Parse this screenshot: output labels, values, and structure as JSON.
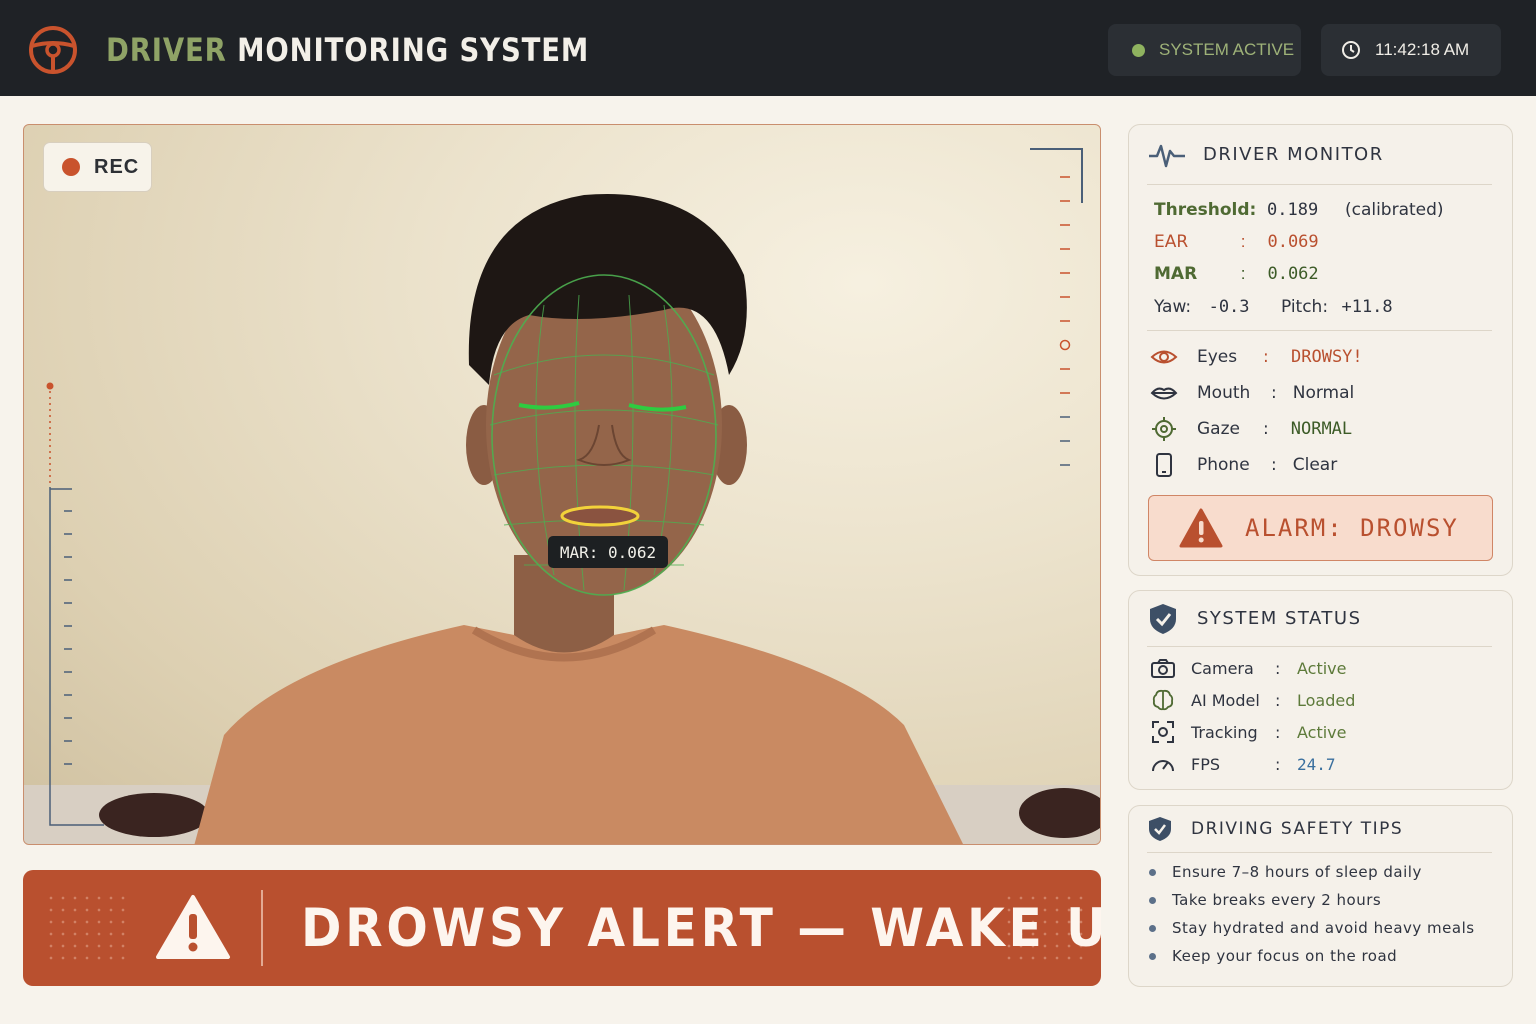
{
  "header": {
    "title_accent": "DRIVER",
    "title_rest": "MONITORING SYSTEM",
    "status_label": "SYSTEM ACTIVE",
    "clock": "11:42:18 AM",
    "logo_icon": "steering-wheel-icon"
  },
  "camera": {
    "rec_label": "REC",
    "mar_overlay": "MAR: 0.062"
  },
  "alert_banner": {
    "text": "DROWSY ALERT — WAKE UP!",
    "icon": "warning-icon"
  },
  "driver_monitor": {
    "title": "DRIVER MONITOR",
    "threshold_label": "Threshold:",
    "threshold_value": "0.189",
    "threshold_note": "(calibrated)",
    "ear_label": "EAR",
    "ear_value": "0.069",
    "mar_label": "MAR",
    "mar_value": "0.062",
    "yaw_label": "Yaw:",
    "yaw_value": "-0.3",
    "pitch_label": "Pitch:",
    "pitch_value": "+11.8",
    "statuses": [
      {
        "label": "Eyes",
        "value": "DROWSY!",
        "icon": "eye-icon"
      },
      {
        "label": "Mouth",
        "value": "Normal",
        "icon": "lips-icon"
      },
      {
        "label": "Gaze",
        "value": "NORMAL",
        "icon": "target-icon"
      },
      {
        "label": "Phone",
        "value": "Clear",
        "icon": "phone-icon"
      }
    ],
    "alarm_text": "ALARM: DROWSY"
  },
  "system_status": {
    "title": "SYSTEM STATUS",
    "rows": [
      {
        "label": "Camera",
        "value": "Active",
        "icon": "camera-icon"
      },
      {
        "label": "AI Model",
        "value": "Loaded",
        "icon": "brain-icon"
      },
      {
        "label": "Tracking",
        "value": "Active",
        "icon": "tracking-icon"
      },
      {
        "label": "FPS",
        "value": "24.7",
        "icon": "gauge-icon"
      }
    ]
  },
  "tips": {
    "title": "DRIVING SAFETY TIPS",
    "items": [
      "Ensure 7–8 hours of sleep daily",
      "Take breaks every 2 hours",
      "Stay hydrated and avoid heavy meals",
      "Keep your focus on the road"
    ]
  },
  "colors": {
    "accent_orange": "#b9502f",
    "accent_green": "#8fa366",
    "header_bg": "#1f2226"
  }
}
